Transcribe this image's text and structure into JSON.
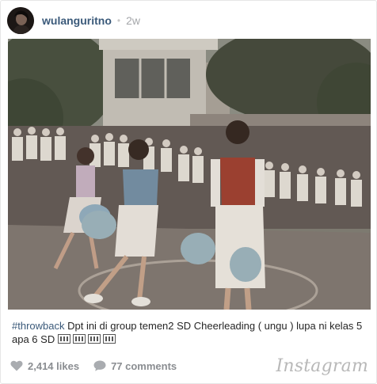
{
  "post": {
    "username": "wulanguritno",
    "separator": "•",
    "time_ago": "2w",
    "caption_hashtag": "#throwback",
    "caption_text": " Dpt ini di group temen2 SD Cheerleading ( ungu ) lupa ni kelas 5 apa 6 SD ",
    "caption_emoji_count": 4,
    "likes": "2,414 likes",
    "comments": "77 comments",
    "brand": "Instagram"
  },
  "icons": {
    "avatar": "profile-photo",
    "likes": "heart-icon",
    "comments": "speech-bubble-icon"
  },
  "colors": {
    "username": "#3b5a7a",
    "hashtag": "#3b5a7a",
    "muted": "#8a8d91",
    "brand": "#b8b8b8"
  }
}
